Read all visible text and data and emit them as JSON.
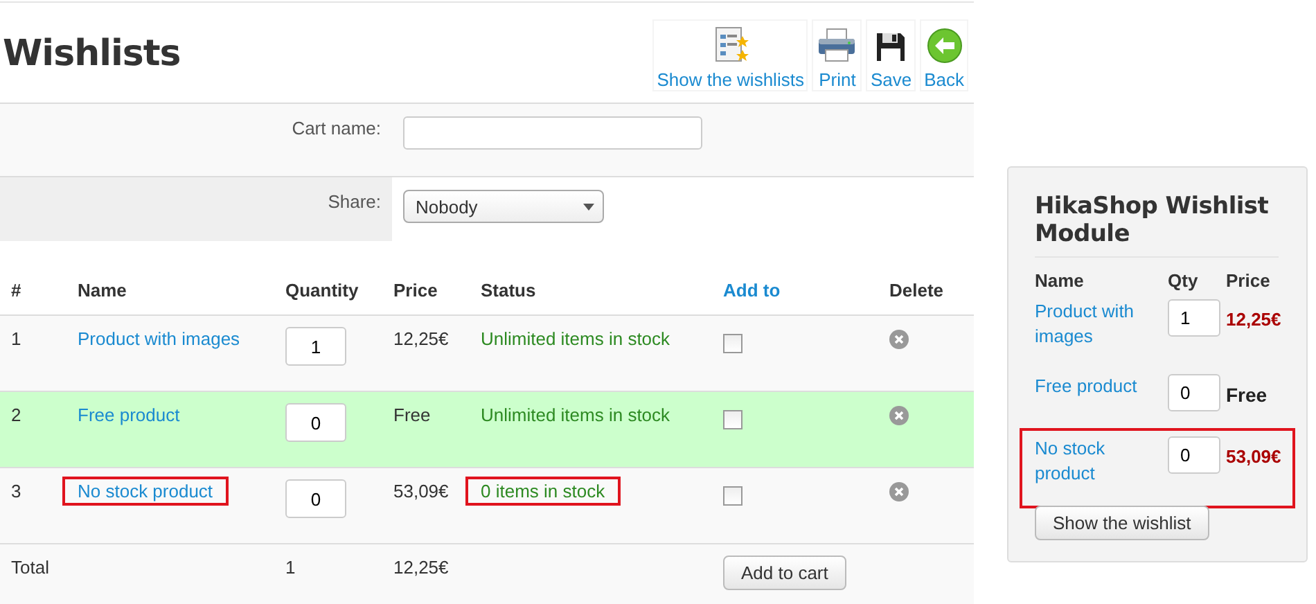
{
  "title": "Wishlists",
  "toolbar": [
    {
      "kind": "list",
      "label": "Show the wishlists"
    },
    {
      "kind": "print",
      "label": "Print"
    },
    {
      "kind": "save",
      "label": "Save"
    },
    {
      "kind": "back",
      "label": "Back"
    }
  ],
  "form": {
    "cart_name": {
      "label": "Cart name:"
    },
    "share": {
      "label": "Share:",
      "value": "Nobody"
    }
  },
  "table": {
    "columns": [
      "#",
      "Name",
      "Quantity",
      "Price",
      "Status",
      "Add to",
      "Delete"
    ],
    "rows": [
      {
        "number": "1",
        "name": "Product with images",
        "name_marked": false,
        "quantity": "1",
        "price": "12,25€",
        "status": "Unlimited items in stock",
        "status_marked": false,
        "add_checked": false,
        "color": "#f9f9f9"
      },
      {
        "number": "2",
        "name": "Free product",
        "name_marked": false,
        "quantity": "0",
        "price": "Free",
        "status": "Unlimited items in stock",
        "status_marked": false,
        "add_checked": false,
        "color": "#ccffcc"
      },
      {
        "number": "3",
        "name": "No stock product",
        "name_marked": true,
        "quantity": "0",
        "price": "53,09€",
        "status": "0 items in stock",
        "status_marked": true,
        "add_checked": false,
        "color": "#f9f9f9"
      }
    ],
    "total": {
      "label": "Total",
      "quantity": "1",
      "price": "12,25€",
      "button": "Add to cart"
    }
  },
  "module": {
    "title": "HikaShop Wishlist Module",
    "columns": [
      "Name",
      "Qty",
      "Price"
    ],
    "rows": [
      {
        "name": "Product with images",
        "qty": "1",
        "price": "12,25€",
        "price_highlighted": true,
        "marked": false
      },
      {
        "name": "Free product",
        "qty": "0",
        "price": "Free",
        "price_highlighted": false,
        "marked": false
      },
      {
        "name": "No stock product",
        "qty": "0",
        "price": "53,09€",
        "price_highlighted": true,
        "marked": true
      }
    ],
    "button": "Show the wishlist"
  }
}
